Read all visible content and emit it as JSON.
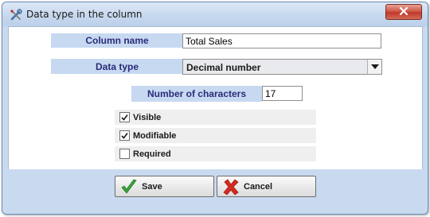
{
  "window": {
    "title": "Data type in the column"
  },
  "form": {
    "column_name": {
      "label": "Column name",
      "value": "Total Sales"
    },
    "data_type": {
      "label": "Data type",
      "selected": "Decimal number"
    },
    "num_chars": {
      "label": "Number of characters",
      "value": "17"
    }
  },
  "checkboxes": {
    "visible": {
      "label": "Visible",
      "checked": true
    },
    "modifiable": {
      "label": "Modifiable",
      "checked": true
    },
    "required": {
      "label": "Required",
      "checked": false
    }
  },
  "buttons": {
    "save": "Save",
    "cancel": "Cancel"
  },
  "colors": {
    "label_bg": "#c7d9f1",
    "label_text": "#2b2b7a",
    "save_check": "#37a33a",
    "cancel_x": "#d42a1f"
  },
  "icons": {
    "title": "wrench-screwdriver-icon",
    "close": "close-icon",
    "dropdown": "triangle-down-icon",
    "save": "green-checkmark-icon",
    "cancel": "red-x-icon"
  }
}
